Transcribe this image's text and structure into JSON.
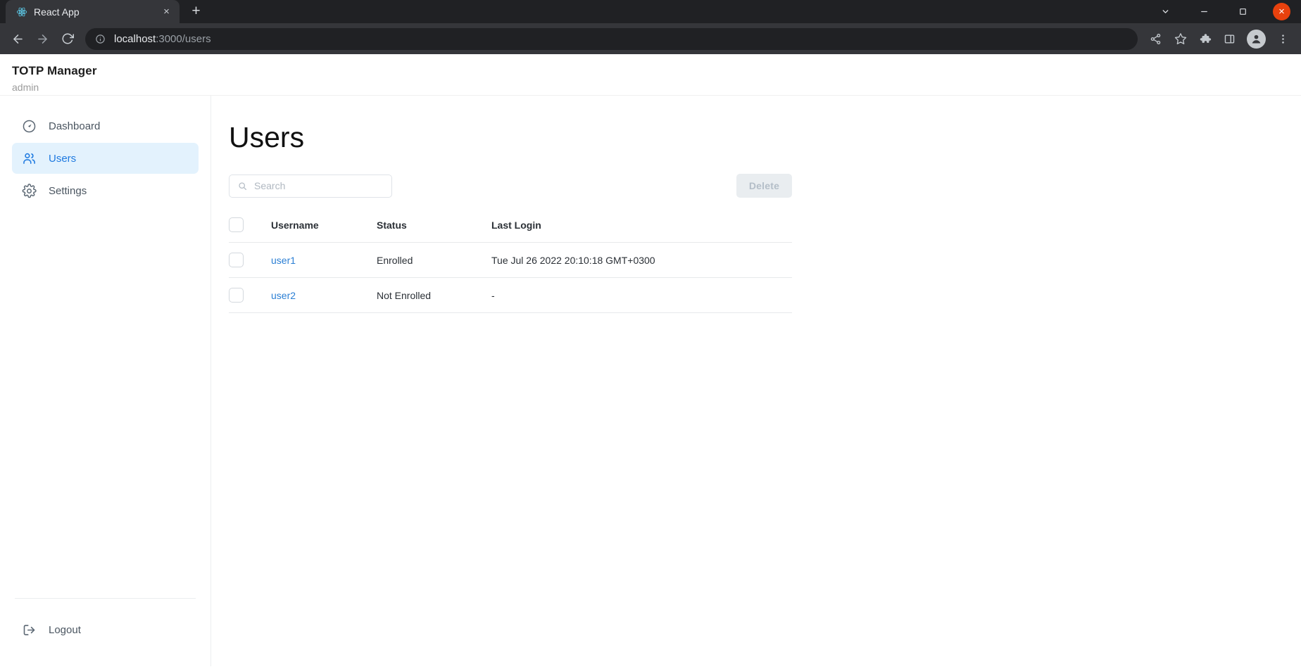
{
  "browser": {
    "tab": {
      "title": "React App",
      "favicon_name": "react-logo-icon",
      "close_label": "×"
    },
    "newtab_label": "+",
    "window_controls": {
      "tab_search": "tab-search-chevron-icon",
      "minimize": "minimize-icon",
      "maximize": "maximize-icon",
      "close": "×"
    },
    "toolbar": {
      "back": "back-arrow-icon",
      "forward": "forward-arrow-icon",
      "reload": "reload-icon",
      "info": "site-info-icon",
      "url_host": "localhost",
      "url_path": ":3000/users",
      "url_full": "localhost:3000/users",
      "share": "share-icon",
      "bookmark": "star-icon",
      "extensions": "puzzle-icon",
      "side_panel": "side-panel-icon",
      "profile": "avatar-icon",
      "menu": "three-dot-menu-icon"
    }
  },
  "app": {
    "title": "TOTP Manager",
    "user": "admin"
  },
  "sidebar": {
    "items": [
      {
        "label": "Dashboard",
        "icon": "dashboard-gauge-icon",
        "active": false
      },
      {
        "label": "Users",
        "icon": "users-icon",
        "active": true
      },
      {
        "label": "Settings",
        "icon": "gear-icon",
        "active": false
      }
    ],
    "logout": {
      "label": "Logout",
      "icon": "logout-icon"
    }
  },
  "main": {
    "page_title": "Users",
    "search": {
      "placeholder": "Search",
      "value": "",
      "icon": "search-icon"
    },
    "delete_button": {
      "label": "Delete",
      "disabled": true
    },
    "table": {
      "columns": [
        "",
        "Username",
        "Status",
        "Last Login"
      ],
      "rows": [
        {
          "checked": false,
          "username": "user1",
          "status": "Enrolled",
          "last_login": "Tue Jul 26 2022 20:10:18 GMT+0300"
        },
        {
          "checked": false,
          "username": "user2",
          "status": "Not Enrolled",
          "last_login": "-"
        }
      ]
    }
  },
  "colors": {
    "accent_blue": "#1f7ae0",
    "active_nav_bg": "#e3f2fd",
    "link_blue": "#2b7fd4",
    "chrome_dark": "#35363a",
    "chrome_darker": "#202124",
    "close_red": "#e8410d"
  }
}
